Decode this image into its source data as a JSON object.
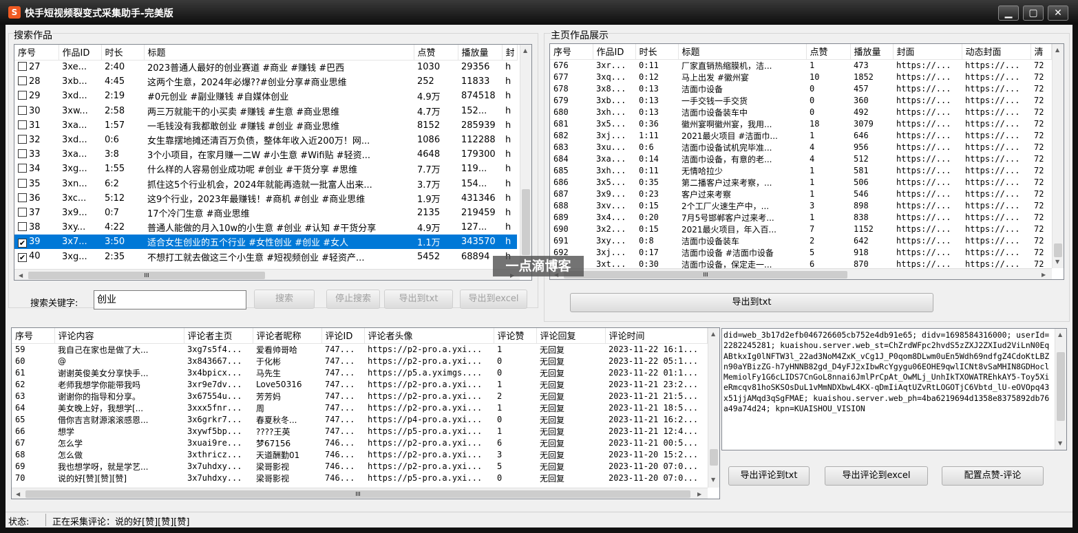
{
  "window": {
    "title": "快手短视频裂变式采集助手-完美版",
    "app_icon_glyph": "S",
    "minimize": "▁",
    "maximize": "▢",
    "close": "✕"
  },
  "search_group": {
    "label": "搜索作品",
    "columns": [
      "序号",
      "作品ID",
      "时长",
      "标题",
      "点赞",
      "播放量",
      "封"
    ],
    "rows": [
      {
        "no": "27",
        "checked": false,
        "id": "3xe...",
        "dur": "2:40",
        "title": "2023普通人最好的创业赛道 #商业 #赚钱 #巴西",
        "likes": "1030",
        "plays": "29356",
        "cover": "h"
      },
      {
        "no": "28",
        "checked": false,
        "id": "3xb...",
        "dur": "4:45",
        "title": "这两个生意，2024年必爆??#创业分享#商业思维",
        "likes": "252",
        "plays": "11833",
        "cover": "h"
      },
      {
        "no": "29",
        "checked": false,
        "id": "3xd...",
        "dur": "2:19",
        "title": "#0元创业 #副业赚钱 #自媒体创业",
        "likes": "4.9万",
        "plays": "874518",
        "cover": "h"
      },
      {
        "no": "30",
        "checked": false,
        "id": "3xw...",
        "dur": "2:58",
        "title": "两三万就能干的小买卖 #赚钱 #生意 #商业思维",
        "likes": "4.7万",
        "plays": "152...",
        "cover": "h"
      },
      {
        "no": "31",
        "checked": false,
        "id": "3xa...",
        "dur": "1:57",
        "title": "一毛钱没有我都敢创业 #赚钱 #创业 #商业思维",
        "likes": "8152",
        "plays": "285939",
        "cover": "h"
      },
      {
        "no": "32",
        "checked": false,
        "id": "3xd...",
        "dur": "0:6",
        "title": "女生靠摆地摊还清百万负债，整体年收入近200万！网...",
        "likes": "1086",
        "plays": "112288",
        "cover": "h"
      },
      {
        "no": "33",
        "checked": false,
        "id": "3xa...",
        "dur": "3:8",
        "title": "3个小项目，在家月赚一二W #小生意 #Wifi贴 #轻资...",
        "likes": "4648",
        "plays": "179300",
        "cover": "h"
      },
      {
        "no": "34",
        "checked": false,
        "id": "3xg...",
        "dur": "1:55",
        "title": "什么样的人容易创业成功呢 #创业 #干货分享 #思维",
        "likes": "7.7万",
        "plays": "119...",
        "cover": "h"
      },
      {
        "no": "35",
        "checked": false,
        "id": "3xn...",
        "dur": "6:2",
        "title": "抓住这5个行业机会，2024年就能再造就一批富人出来...",
        "likes": "3.7万",
        "plays": "154...",
        "cover": "h"
      },
      {
        "no": "36",
        "checked": false,
        "id": "3xc...",
        "dur": "5:12",
        "title": "这9个行业，2023年最赚钱！#商机 #创业 #商业思维",
        "likes": "1.9万",
        "plays": "431346",
        "cover": "h"
      },
      {
        "no": "37",
        "checked": false,
        "id": "3x9...",
        "dur": "0:7",
        "title": "17个冷门生意 #商业思维",
        "likes": "2135",
        "plays": "219459",
        "cover": "h"
      },
      {
        "no": "38",
        "checked": false,
        "id": "3xy...",
        "dur": "4:22",
        "title": "普通人能做的月入10w的小生意 #创业 #认知 #干货分享",
        "likes": "4.9万",
        "plays": "127...",
        "cover": "h"
      },
      {
        "no": "39",
        "checked": true,
        "selected": true,
        "id": "3x7...",
        "dur": "3:50",
        "title": "适合女生创业的五个行业 #女性创业 #创业 #女人",
        "likes": "1.1万",
        "plays": "343570",
        "cover": "h"
      },
      {
        "no": "40",
        "checked": true,
        "id": "3xg...",
        "dur": "2:35",
        "title": "不想打工就去做这三个小生意 #短视频创业 #轻资产...",
        "likes": "5452",
        "plays": "68894",
        "cover": "h"
      }
    ],
    "keyword_label": "搜索关键字:",
    "keyword_value": "创业",
    "btn_search": "搜索",
    "btn_stop": "停止搜索",
    "btn_export_txt": "导出到txt",
    "btn_export_excel": "导出到excel"
  },
  "home_group": {
    "label": "主页作品展示",
    "columns": [
      "序号",
      "作品ID",
      "时长",
      "标题",
      "点赞",
      "播放量",
      "封面",
      "动态封面",
      "清"
    ],
    "rows": [
      {
        "no": "676",
        "id": "3xr...",
        "dur": "0:11",
        "title": "厂家直销热缩膜机，洁...",
        "likes": "1",
        "plays": "473",
        "cover": "https://...",
        "dyn": "https://...",
        "q": "72"
      },
      {
        "no": "677",
        "id": "3xq...",
        "dur": "0:12",
        "title": "马上出发 #徽州宴",
        "likes": "10",
        "plays": "1852",
        "cover": "https://...",
        "dyn": "https://...",
        "q": "72"
      },
      {
        "no": "678",
        "id": "3x8...",
        "dur": "0:13",
        "title": "洁面巾设备",
        "likes": "0",
        "plays": "457",
        "cover": "https://...",
        "dyn": "https://...",
        "q": "72"
      },
      {
        "no": "679",
        "id": "3xb...",
        "dur": "0:13",
        "title": "一手交钱一手交货",
        "likes": "0",
        "plays": "360",
        "cover": "https://...",
        "dyn": "https://...",
        "q": "72"
      },
      {
        "no": "680",
        "id": "3xh...",
        "dur": "0:13",
        "title": "洁面巾设备装车中",
        "likes": "0",
        "plays": "492",
        "cover": "https://...",
        "dyn": "https://...",
        "q": "72"
      },
      {
        "no": "681",
        "id": "3x5...",
        "dur": "0:36",
        "title": "徽州宴啊徽州宴，我用...",
        "likes": "18",
        "plays": "3079",
        "cover": "https://...",
        "dyn": "https://...",
        "q": "72"
      },
      {
        "no": "682",
        "id": "3xj...",
        "dur": "1:11",
        "title": "2021最火项目 #洁面巾...",
        "likes": "1",
        "plays": "646",
        "cover": "https://...",
        "dyn": "https://...",
        "q": "72"
      },
      {
        "no": "683",
        "id": "3xu...",
        "dur": "0:6",
        "title": "洁面巾设备试机完毕准...",
        "likes": "4",
        "plays": "956",
        "cover": "https://...",
        "dyn": "https://...",
        "q": "72"
      },
      {
        "no": "684",
        "id": "3xa...",
        "dur": "0:14",
        "title": "洁面巾设备，有意的老...",
        "likes": "4",
        "plays": "512",
        "cover": "https://...",
        "dyn": "https://...",
        "q": "72"
      },
      {
        "no": "685",
        "id": "3xh...",
        "dur": "0:11",
        "title": "无情哈拉少",
        "likes": "1",
        "plays": "581",
        "cover": "https://...",
        "dyn": "https://...",
        "q": "72"
      },
      {
        "no": "686",
        "id": "3x5...",
        "dur": "0:35",
        "title": "第二播客户过来考察，...",
        "likes": "1",
        "plays": "506",
        "cover": "https://...",
        "dyn": "https://...",
        "q": "72"
      },
      {
        "no": "687",
        "id": "3x9...",
        "dur": "0:23",
        "title": "客户过来考察",
        "likes": "1",
        "plays": "546",
        "cover": "https://...",
        "dyn": "https://...",
        "q": "72"
      },
      {
        "no": "688",
        "id": "3xv...",
        "dur": "0:15",
        "title": "2个工厂火速生产中，...",
        "likes": "3",
        "plays": "898",
        "cover": "https://...",
        "dyn": "https://...",
        "q": "72"
      },
      {
        "no": "689",
        "id": "3x4...",
        "dur": "0:20",
        "title": "7月5号邯郸客户过来考...",
        "likes": "1",
        "plays": "838",
        "cover": "https://...",
        "dyn": "https://...",
        "q": "72"
      },
      {
        "no": "690",
        "id": "3x2...",
        "dur": "0:15",
        "title": "2021最火项目，年入百...",
        "likes": "7",
        "plays": "1152",
        "cover": "https://...",
        "dyn": "https://...",
        "q": "72"
      },
      {
        "no": "691",
        "id": "3xy...",
        "dur": "0:8",
        "title": "洁面巾设备装车",
        "likes": "2",
        "plays": "642",
        "cover": "https://...",
        "dyn": "https://...",
        "q": "72"
      },
      {
        "no": "692",
        "id": "3xj...",
        "dur": "0:17",
        "title": "洁面巾设备 #洁面巾设备",
        "likes": "5",
        "plays": "918",
        "cover": "https://...",
        "dyn": "https://...",
        "q": "72"
      },
      {
        "no": "693",
        "id": "3xt...",
        "dur": "0:30",
        "title": "洁面巾设备，保定走一...",
        "likes": "6",
        "plays": "870",
        "cover": "https://...",
        "dyn": "https://...",
        "q": "72"
      }
    ],
    "btn_export_txt": "导出到txt"
  },
  "comments": {
    "columns": [
      "序号",
      "评论内容",
      "评论者主页",
      "评论者昵称",
      "评论ID",
      "评论者头像",
      "评论赞",
      "评论回复",
      "评论时间"
    ],
    "rows": [
      {
        "no": "59",
        "content": "我自己在家也是做了大...",
        "home": "3xg7s5f4...",
        "nick": "爱看帅哥哈",
        "cid": "747...",
        "avatar": "https://p2-pro.a.yxi...",
        "likes": "1",
        "reply": "无回复",
        "time": "2023-11-22 16:1..."
      },
      {
        "no": "60",
        "content": "@",
        "home": "3x843667...",
        "nick": "于化彬",
        "cid": "747...",
        "avatar": "https://p2-pro.a.yxi...",
        "likes": "0",
        "reply": "无回复",
        "time": "2023-11-22 05:1..."
      },
      {
        "no": "61",
        "content": "谢谢英俊美女分享快手...",
        "home": "3x4bpicx...",
        "nick": "马先生",
        "cid": "747...",
        "avatar": "https://p5.a.yximgs....",
        "likes": "0",
        "reply": "无回复",
        "time": "2023-11-22 01:1..."
      },
      {
        "no": "62",
        "content": "老师我想学你能带我吗",
        "home": "3xr9e7dv...",
        "nick": "Love50316",
        "cid": "747...",
        "avatar": "https://p2-pro.a.yxi...",
        "likes": "1",
        "reply": "无回复",
        "time": "2023-11-21 23:2..."
      },
      {
        "no": "63",
        "content": "谢谢你的指导和分享。",
        "home": "3x67554u...",
        "nick": "芳芳妈",
        "cid": "747...",
        "avatar": "https://p2-pro.a.yxi...",
        "likes": "2",
        "reply": "无回复",
        "time": "2023-11-21 21:5..."
      },
      {
        "no": "64",
        "content": "美女晚上好，我想学[...",
        "home": "3xxx5fnr...",
        "nick": "周",
        "cid": "747...",
        "avatar": "https://p2-pro.a.yxi...",
        "likes": "1",
        "reply": "无回复",
        "time": "2023-11-21 18:5..."
      },
      {
        "no": "65",
        "content": "借你吉言财源滚滚感恩...",
        "home": "3x6grkr7...",
        "nick": "春夏秋冬...",
        "cid": "747...",
        "avatar": "https://p4-pro.a.yxi...",
        "likes": "0",
        "reply": "无回复",
        "time": "2023-11-21 16:2..."
      },
      {
        "no": "66",
        "content": "想学",
        "home": "3xywf5bp...",
        "nick": "????王英",
        "cid": "747...",
        "avatar": "https://p5-pro.a.yxi...",
        "likes": "1",
        "reply": "无回复",
        "time": "2023-11-21 12:4..."
      },
      {
        "no": "67",
        "content": "怎么学",
        "home": "3xuai9re...",
        "nick": "梦67156",
        "cid": "746...",
        "avatar": "https://p2-pro.a.yxi...",
        "likes": "6",
        "reply": "无回复",
        "time": "2023-11-21 00:5..."
      },
      {
        "no": "68",
        "content": "怎么做",
        "home": "3xthricz...",
        "nick": "天道酬勤01",
        "cid": "746...",
        "avatar": "https://p2-pro.a.yxi...",
        "likes": "3",
        "reply": "无回复",
        "time": "2023-11-20 15:2..."
      },
      {
        "no": "69",
        "content": "我也想学呀，就是学艺...",
        "home": "3x7uhdxy...",
        "nick": "梁哥影视",
        "cid": "746...",
        "avatar": "https://p2-pro.a.yxi...",
        "likes": "5",
        "reply": "无回复",
        "time": "2023-11-20 07:0..."
      },
      {
        "no": "70",
        "content": "说的好[赞][赞][赞]",
        "home": "3x7uhdxy...",
        "nick": "梁哥影视",
        "cid": "746...",
        "avatar": "https://p5-pro.a.yxi...",
        "likes": "0",
        "reply": "无回复",
        "time": "2023-11-20 07:0..."
      }
    ]
  },
  "cookie_text": "did=web_3b17d2efb046726605cb752e4db91e65; didv=1698584316000; userId=2282245281; kuaishou.server.web_st=ChZrdWFpc2hvdS5zZXJ2ZXIud2ViLnN0EqABtkxIg0lNFTW3l_22ad3NoM4ZxK_vCg1J_P0qom8DLwm0uEn5Wdh69ndfgZ4CdoKtLBZn90aYBizZG-h7yHNNB82gd_D4yFJ2xIbwRcYgygu06EOHE9qwlICNt8vSaMHIN8GDHoclMemiolFy1G6cLIDS7CnGoL8nnai6JmlPrCpAt_OwMLj_UnhIkTXOWATREhkAY5-Toy5XieRmcqv81hoSKSOsDuL1vMmNDXbwL4KX-qDmIiAqtUZvRtLOGOTjC6Vbtd_lU-eOVOpq43x51jjAMqd3qSgFMAE; kuaishou.server.web_ph=4ba6219694d1358e8375892db76a49a74d24; kpn=KUAISHOU_VISION",
  "comment_buttons": {
    "export_txt": "导出评论到txt",
    "export_excel": "导出评论到excel",
    "config": "配置点赞-评论"
  },
  "status": {
    "label": "状态:",
    "text": "正在采集评论：说的好[赞][赞][赞]"
  },
  "watermark": "一点滴博客",
  "scroll_glyphs": {
    "left": "◀",
    "right": "▶",
    "up": "▲",
    "down": "▼",
    "grip": "III"
  },
  "colors": {
    "selection": "#0078d7",
    "title_bar": "#1a1a1a"
  }
}
